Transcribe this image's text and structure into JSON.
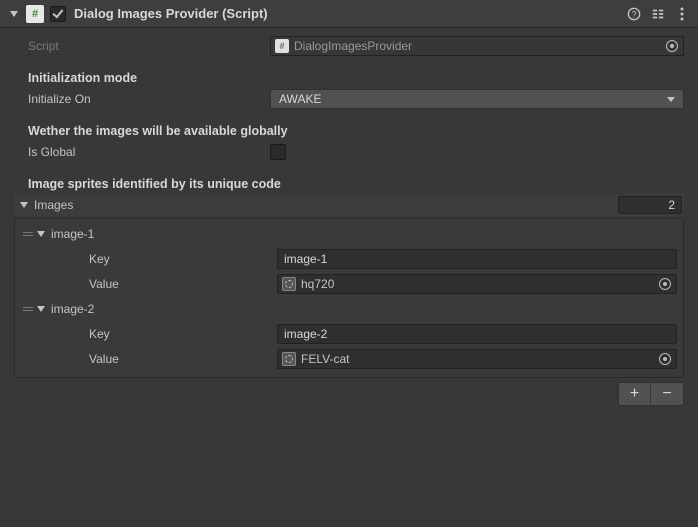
{
  "header": {
    "title": "Dialog Images Provider (Script)",
    "enabled": true
  },
  "script": {
    "label": "Script",
    "value": "DialogImagesProvider"
  },
  "sections": {
    "init_heading": "Initialization mode",
    "init_label": "Initialize On",
    "init_value": "AWAKE",
    "global_heading": "Wether the images will be available globally",
    "global_label": "Is Global",
    "global_checked": false,
    "sprites_heading": "Image sprites identified by its unique code"
  },
  "images": {
    "label": "Images",
    "size": "2",
    "key_label": "Key",
    "value_label": "Value",
    "items": [
      {
        "name": "image-1",
        "key": "image-1",
        "value": "hq720"
      },
      {
        "name": "image-2",
        "key": "image-2",
        "value": "FELV-cat"
      }
    ]
  },
  "footer": {
    "add": "+",
    "remove": "−"
  }
}
